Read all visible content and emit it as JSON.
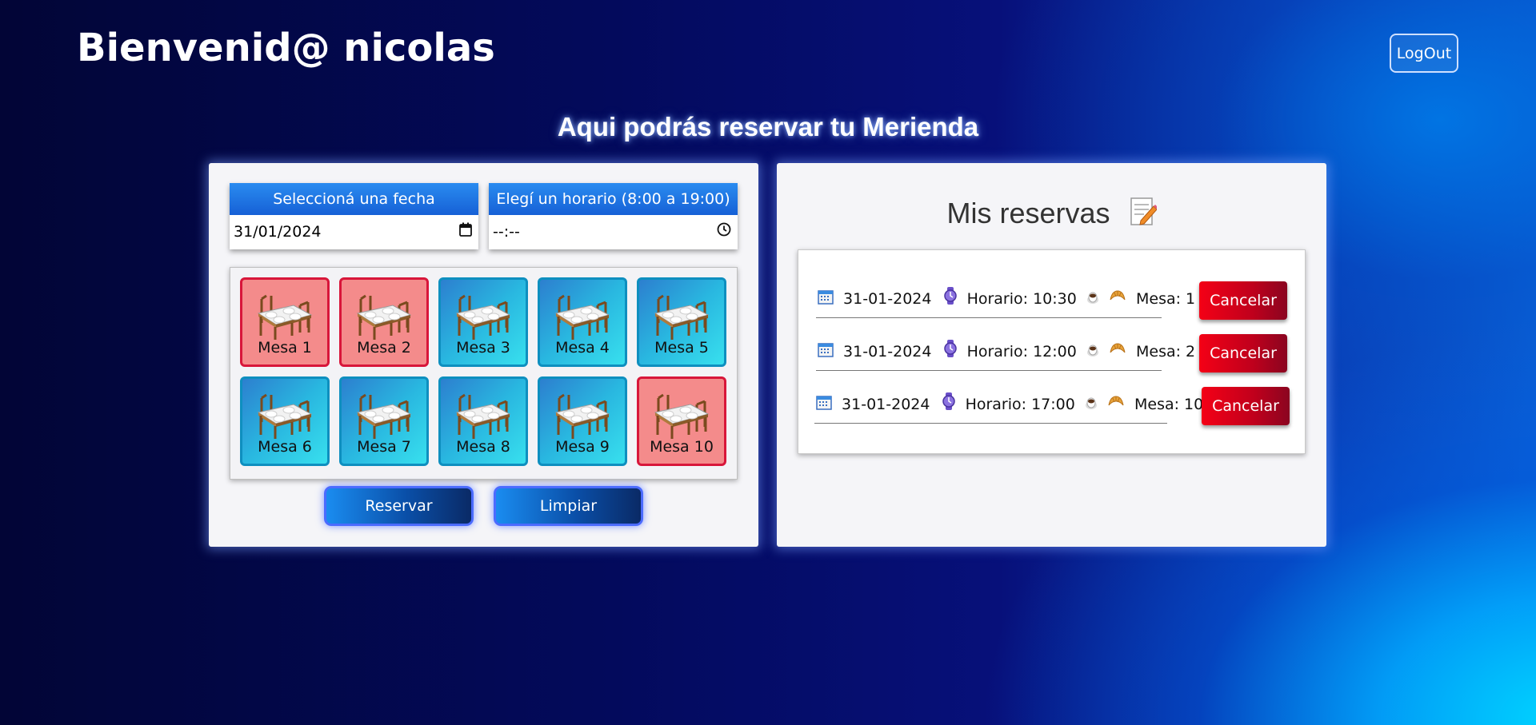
{
  "header": {
    "welcome": "Bienvenid@ nicolas",
    "logout_label": "LogOut"
  },
  "subtitle": "Aqui podrás reservar tu Merienda",
  "booking": {
    "date_label": "Seleccioná una fecha",
    "date_value": "31/01/2024",
    "time_label": "Elegí un horario (8:00 a 19:00)",
    "time_value": "--:--",
    "tables": [
      {
        "label": "Mesa 1",
        "status": "occupied"
      },
      {
        "label": "Mesa 2",
        "status": "occupied"
      },
      {
        "label": "Mesa 3",
        "status": "available"
      },
      {
        "label": "Mesa 4",
        "status": "available"
      },
      {
        "label": "Mesa 5",
        "status": "available"
      },
      {
        "label": "Mesa 6",
        "status": "available"
      },
      {
        "label": "Mesa 7",
        "status": "available"
      },
      {
        "label": "Mesa 8",
        "status": "available"
      },
      {
        "label": "Mesa 9",
        "status": "available"
      },
      {
        "label": "Mesa 10",
        "status": "occupied"
      }
    ],
    "reserve_label": "Reservar",
    "clear_label": "Limpiar"
  },
  "reservations": {
    "title": "Mis reservas",
    "items": [
      {
        "date": "31-01-2024",
        "time": "Horario: 10:30",
        "table": "Mesa: 1",
        "cancel_label": "Cancelar"
      },
      {
        "date": "31-01-2024",
        "time": "Horario: 12:00",
        "table": "Mesa: 2",
        "cancel_label": "Cancelar"
      },
      {
        "date": "31-01-2024",
        "time": "Horario: 17:00",
        "table": "Mesa: 10",
        "cancel_label": "Cancelar"
      }
    ]
  },
  "colors": {
    "table_available": "#2fb3dd",
    "table_occupied": "#f48b8b",
    "cancel": "#e0001a",
    "accent": "#1a8cf0"
  },
  "icons": [
    "calendar-icon",
    "clock-icon",
    "watch-icon",
    "coffee-icon",
    "croissant-icon",
    "memo-icon",
    "dining-table-icon"
  ]
}
